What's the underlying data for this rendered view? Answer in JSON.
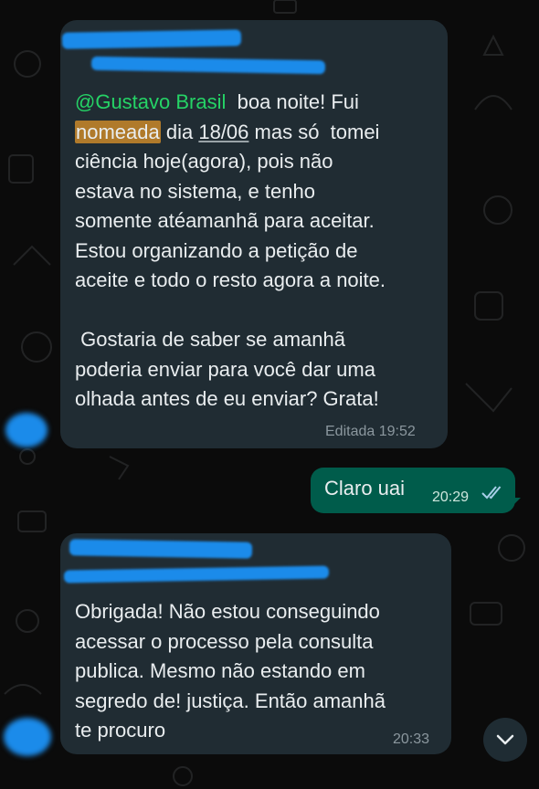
{
  "messages": {
    "first": {
      "mention": "@Gustavo Brasil",
      "intro": "  boa noite! Fui",
      "highlight": "nomeada",
      "pre_date": " dia ",
      "date": "18/06",
      "post_date": " mas só  tomei",
      "rest": "ciência hoje(agora), pois não\nestava no sistema, e tenho\nsomente atéamanhã para aceitar.\nEstou organizando a petição de\naceite e todo o resto agora a noite.\n\n Gostaria de saber se amanhã\npoderia enviar para você dar uma\nolhada antes de eu enviar? Grata!",
      "status": "Editada 19:52"
    },
    "reply": {
      "text": "Claro uai",
      "time": "20:29"
    },
    "second": {
      "text": "Obrigada! Não estou conseguindo\nacessar o processo pela consulta\npublica. Mesmo não estando em\nsegredo de! justiça. Então amanhã\nte procuro",
      "time": "20:33"
    }
  },
  "icons": {
    "read_receipt": "double-check-icon",
    "scroll_down": "chevron-down-icon"
  },
  "colors": {
    "incoming_bubble": "#202c33",
    "outgoing_bubble": "#005c4b",
    "mention": "#25d366",
    "highlight": "#b07a2b",
    "redaction": "#1b8bea",
    "read_ticks": "#a8cfe8"
  }
}
